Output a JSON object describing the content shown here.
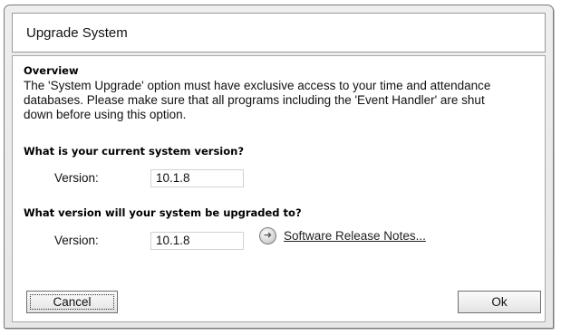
{
  "window": {
    "title": "Upgrade System"
  },
  "overview": {
    "heading": "Overview",
    "lines": [
      "The 'System Upgrade' option must have exclusive access to your time and attendance",
      "databases. Please make sure that all programs including the 'Event Handler' are shut",
      "down before using this option."
    ]
  },
  "current": {
    "heading": "What is your current system version?",
    "label": "Version:",
    "value": "10.1.8"
  },
  "target": {
    "heading": "What version will your system be upgraded to?",
    "label": "Version:",
    "value": "10.1.8",
    "release_notes_link": "Software Release Notes..."
  },
  "buttons": {
    "cancel_label": "Cancel",
    "ok_label": "Ok"
  },
  "icons": {
    "release_notes": "arrow-circle-icon"
  }
}
